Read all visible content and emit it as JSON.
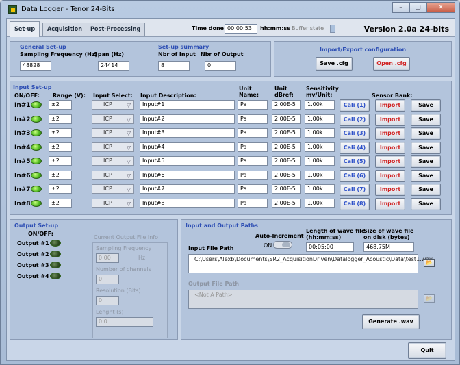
{
  "window": {
    "title": "Data Logger - Tenor 24-Bits",
    "buttons": [
      "–",
      "▢",
      "✕"
    ]
  },
  "topbar": {
    "tabs": [
      "Set-up",
      "Acquisition",
      "Post-Processing"
    ],
    "time_done_label": "Time done",
    "time_done_value": "00:00:53",
    "time_unit": "hh:mm:ss",
    "buffer_label": "Buffer state",
    "version": "Version 2.0a 24-bits"
  },
  "general": {
    "title": "General Set-up",
    "freq_label": "Sampling Frequency (Hz)",
    "freq_value": "48828",
    "span_label": "Span (Hz)",
    "span_value": "24414"
  },
  "summary": {
    "title": "Set-up summary",
    "input_label": "Nbr of Input",
    "input_value": "8",
    "output_label": "Nbr of Output",
    "output_value": "0"
  },
  "import_export": {
    "title": "Import/Export configuration",
    "save": "Save .cfg",
    "open": "Open .cfg"
  },
  "input_setup": {
    "title": "Input Set-up",
    "headers": {
      "onoff": "ON/OFF:",
      "range": "Range (V):",
      "select": "Input Select:",
      "desc": "Input Description:",
      "unit": "Unit\nName:",
      "dbref": "Unit\ndBref:",
      "sens": "Sensitivity\nmv/Unit:",
      "bank": "Sensor Bank:"
    },
    "rows": [
      {
        "label": "In#1",
        "range": "±2",
        "select": "ICP",
        "desc": "Input#1",
        "unit": "Pa",
        "dbref": "2.00E-5",
        "sens": "1.00k",
        "cali": "Cali (1)",
        "imp": "Import",
        "save": "Save"
      },
      {
        "label": "In#2",
        "range": "±2",
        "select": "ICP",
        "desc": "Input#2",
        "unit": "Pa",
        "dbref": "2.00E-5",
        "sens": "1.00k",
        "cali": "Cali (2)",
        "imp": "Import",
        "save": "Save"
      },
      {
        "label": "In#3",
        "range": "±2",
        "select": "ICP",
        "desc": "Input#3",
        "unit": "Pa",
        "dbref": "2.00E-5",
        "sens": "1.00k",
        "cali": "Cali (3)",
        "imp": "Import",
        "save": "Save"
      },
      {
        "label": "In#4",
        "range": "±2",
        "select": "ICP",
        "desc": "Input#4",
        "unit": "Pa",
        "dbref": "2.00E-5",
        "sens": "1.00k",
        "cali": "Cali (4)",
        "imp": "Import",
        "save": "Save"
      },
      {
        "label": "In#5",
        "range": "±2",
        "select": "ICP",
        "desc": "Input#5",
        "unit": "Pa",
        "dbref": "2.00E-5",
        "sens": "1.00k",
        "cali": "Cali (5)",
        "imp": "Import",
        "save": "Save"
      },
      {
        "label": "In#6",
        "range": "±2",
        "select": "ICP",
        "desc": "Input#6",
        "unit": "Pa",
        "dbref": "2.00E-5",
        "sens": "1.00k",
        "cali": "Cali (6)",
        "imp": "Import",
        "save": "Save"
      },
      {
        "label": "In#7",
        "range": "±2",
        "select": "ICP",
        "desc": "Input#7",
        "unit": "Pa",
        "dbref": "2.00E-5",
        "sens": "1.00k",
        "cali": "Cali (7)",
        "imp": "Import",
        "save": "Save"
      },
      {
        "label": "In#8",
        "range": "±2",
        "select": "ICP",
        "desc": "Input#8",
        "unit": "Pa",
        "dbref": "2.00E-5",
        "sens": "1.00k",
        "cali": "Cali (8)",
        "imp": "Import",
        "save": "Save"
      }
    ]
  },
  "output_setup": {
    "title": "Output Set-up",
    "onoff": "ON/OFF:",
    "outputs": [
      "Output #1",
      "Output #2",
      "Output #3",
      "Output #4"
    ],
    "file_info_title": "Current Output File Info",
    "freq_label": "Sampling Frequency",
    "freq_value": "0.00",
    "freq_unit": "Hz",
    "channels_label": "Number of channels",
    "channels_value": "0",
    "resolution_label": "Resolution (Bits)",
    "resolution_value": "0",
    "length_label": "Lenght (s)",
    "length_value": "0.0"
  },
  "paths": {
    "title": "Input and Output Paths",
    "auto_label": "Auto-Increment",
    "on_label": "ON",
    "length_label": "Length of wave file\n(hh:mm:ss)",
    "length_value": "00:05:00",
    "size_label": "Size of wave file\non disk (bytes)",
    "size_value": "468.75M",
    "input_label": "Input File Path",
    "input_prefix": "%",
    "input_value": "C:\\Users\\Alexb\\Documents\\SR2_AcquisitionDriven\\Datalogger_Acoustic\\Data\\test1.wav",
    "output_label": "Output File Path",
    "output_value": "<Not A Path>",
    "generate": "Generate .wav"
  },
  "quit": "Quit",
  "colors": {
    "accent_title": "#2e4fb4",
    "red_text": "#d12323",
    "led_on": "#49b51c"
  }
}
